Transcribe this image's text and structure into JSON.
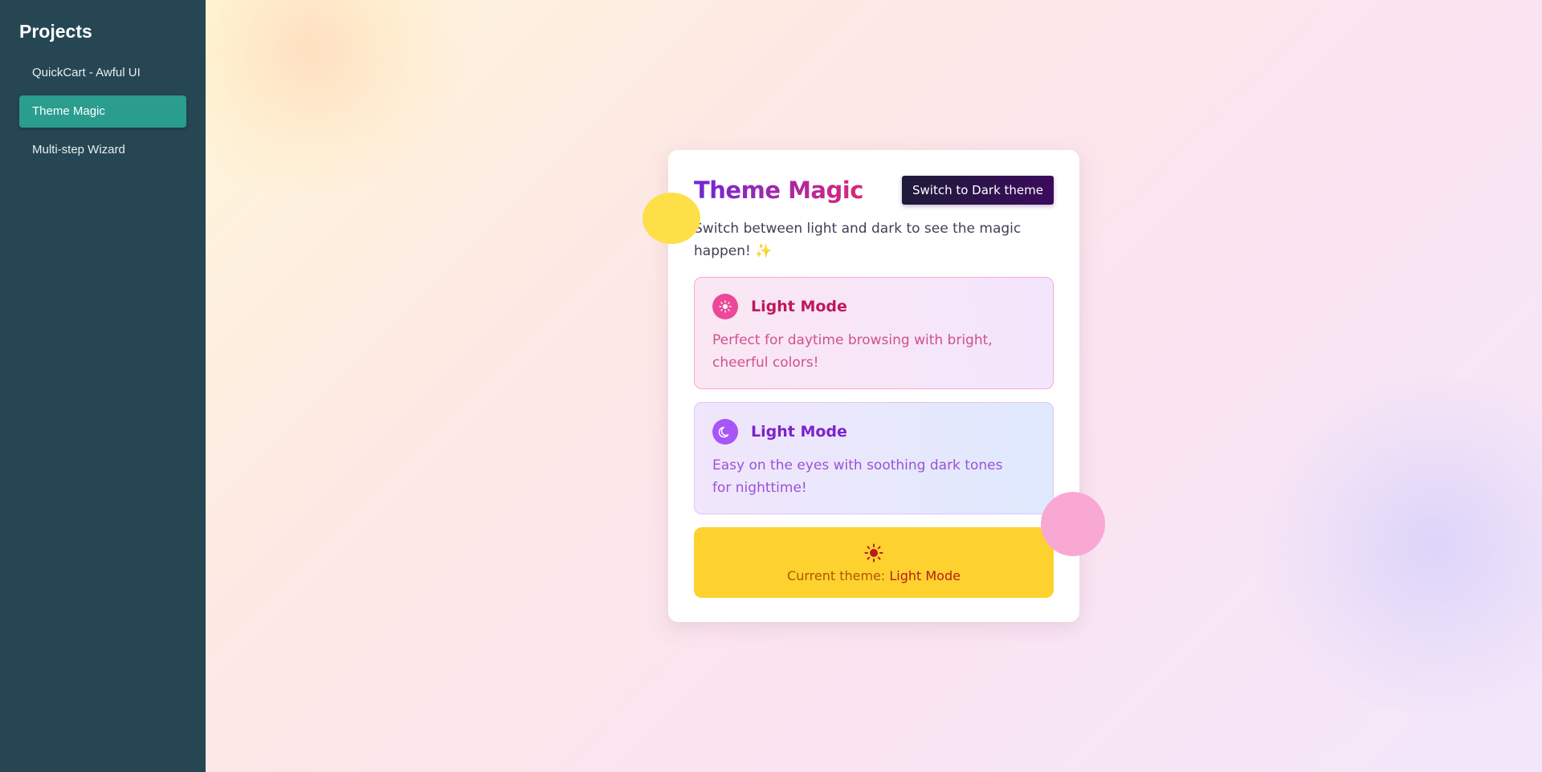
{
  "sidebar": {
    "title": "Projects",
    "items": [
      {
        "label": "QuickCart - Awful UI",
        "active": false
      },
      {
        "label": "Theme Magic",
        "active": true
      },
      {
        "label": "Multi-step Wizard",
        "active": false
      }
    ]
  },
  "card": {
    "title": "Theme Magic",
    "switch_button": "Switch to Dark theme",
    "subtitle": "Switch between light and dark to see the magic happen! ✨",
    "modes": [
      {
        "icon": "sun-icon",
        "title": "Light Mode",
        "description": "Perfect for daytime browsing with bright, cheerful colors!"
      },
      {
        "icon": "moon-icon",
        "title": "Light Mode",
        "description": "Easy on the eyes with soothing dark tones for nighttime!"
      }
    ],
    "current": {
      "icon": "sun-icon",
      "label": "Current theme: ",
      "value": "Light Mode"
    }
  },
  "colors": {
    "sidebar_bg": "#264653",
    "active_item": "#2a9d8f",
    "current_bg": "#fdd22e",
    "light_accent": "#ec4899",
    "dark_accent": "#a855f7"
  }
}
